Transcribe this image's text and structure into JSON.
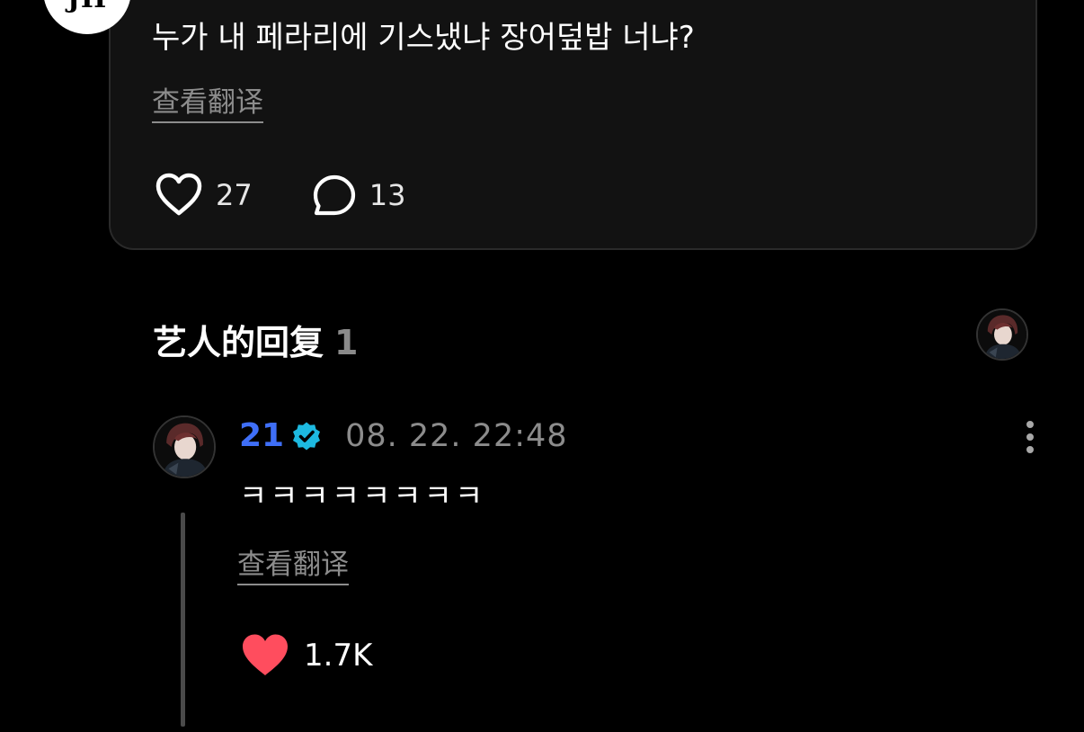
{
  "post": {
    "author_initials": "JH",
    "text": "누가 내 페라리에 기스냈냐 장어덮밥 너냐?",
    "translate_label": "查看翻译",
    "likes": "27",
    "comments": "13"
  },
  "artist_replies": {
    "title": "艺人的回复",
    "count": "1"
  },
  "reply": {
    "username": "21",
    "timestamp": "08. 22. 22:48",
    "text": "ㅋㅋㅋㅋㅋㅋㅋㅋ",
    "translate_label": "查看翻译",
    "likes": "1.7K"
  },
  "colors": {
    "background": "#000000",
    "card": "#121212",
    "username": "#3f6ff7",
    "verified": "#1db9e0",
    "liked_heart": "#ff4d5e",
    "muted_text": "#8c8c8c"
  },
  "icons": {
    "like": "heart-outline-icon",
    "comment": "speech-bubble-icon",
    "verified": "verified-badge-icon",
    "more": "vertical-dots-icon",
    "liked": "heart-filled-icon"
  }
}
